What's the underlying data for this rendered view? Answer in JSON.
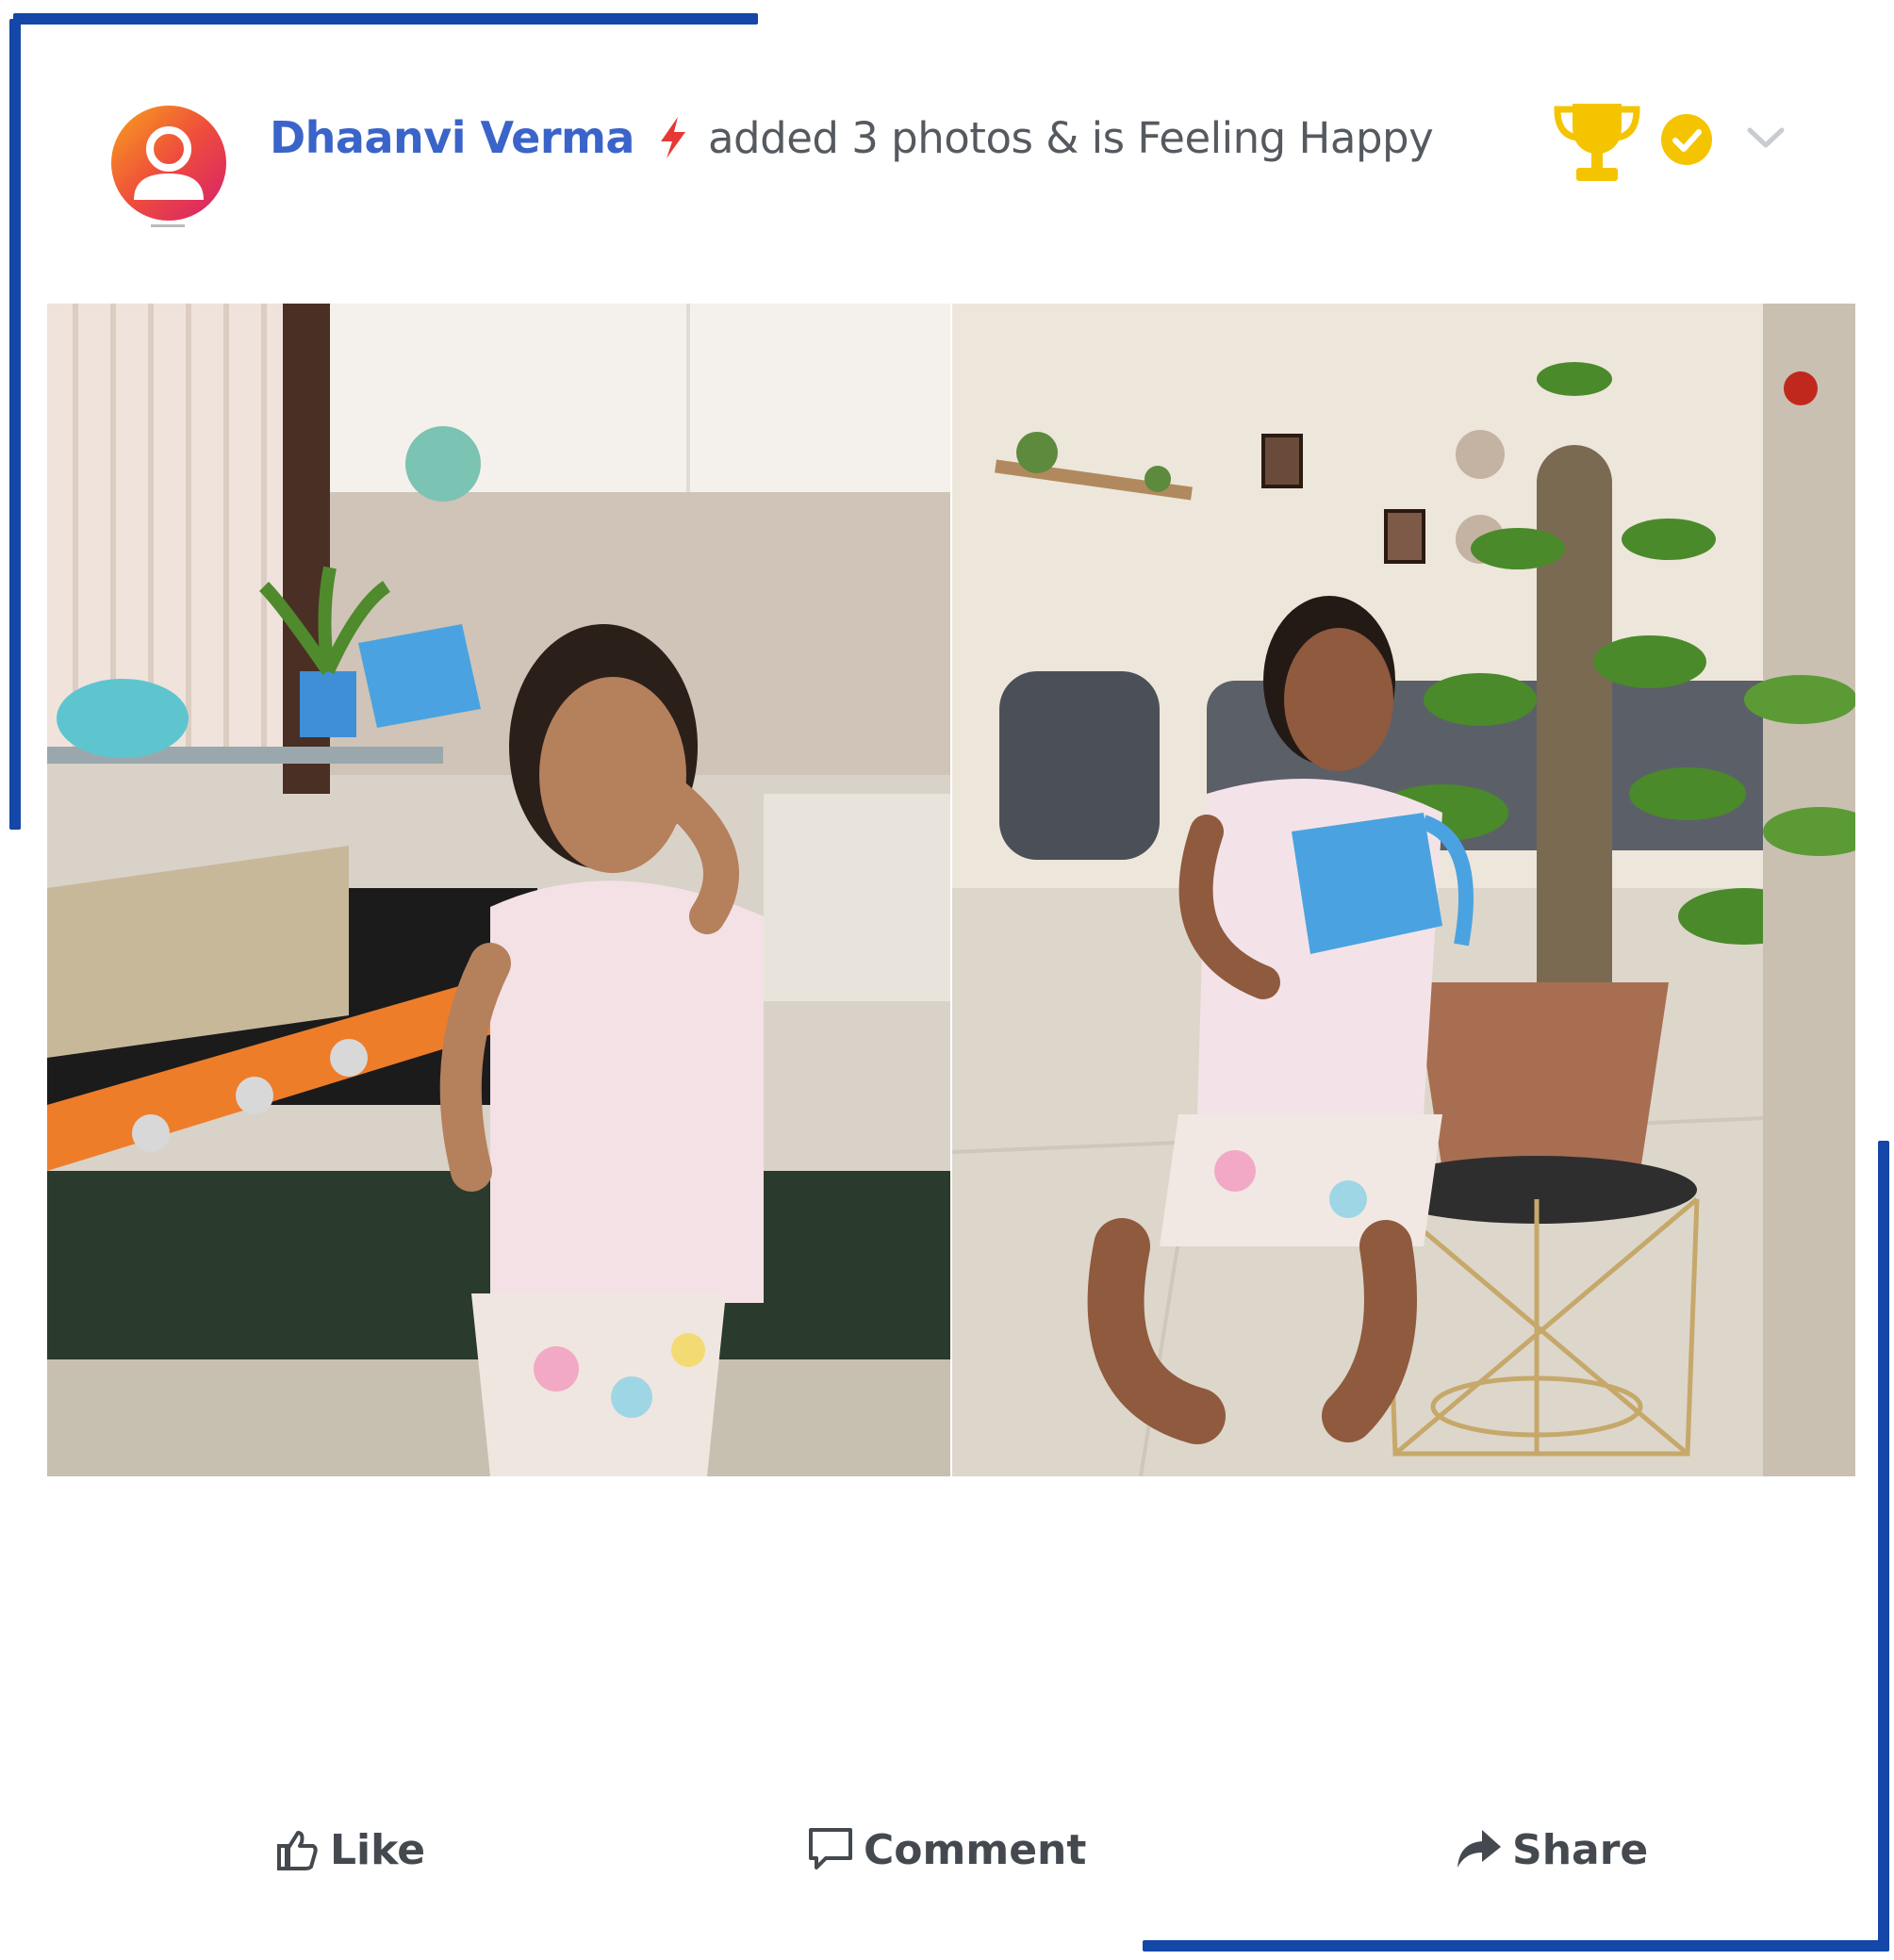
{
  "post": {
    "author": "Dhaanvi Verma",
    "action_text": "added 3 photos & is Feeling Happy",
    "photos": [
      {
        "icon": "photo-girl-kitchen-watering-plant"
      },
      {
        "icon": "photo-girl-watering-potted-plant"
      }
    ]
  },
  "actions": {
    "like_label": "Like",
    "comment_label": "Comment",
    "share_label": "Share"
  },
  "colors": {
    "accent_blue": "#1447a8",
    "author_blue": "#3a64c9",
    "trophy_gold": "#f5c400",
    "bolt_red": "#e53935"
  }
}
